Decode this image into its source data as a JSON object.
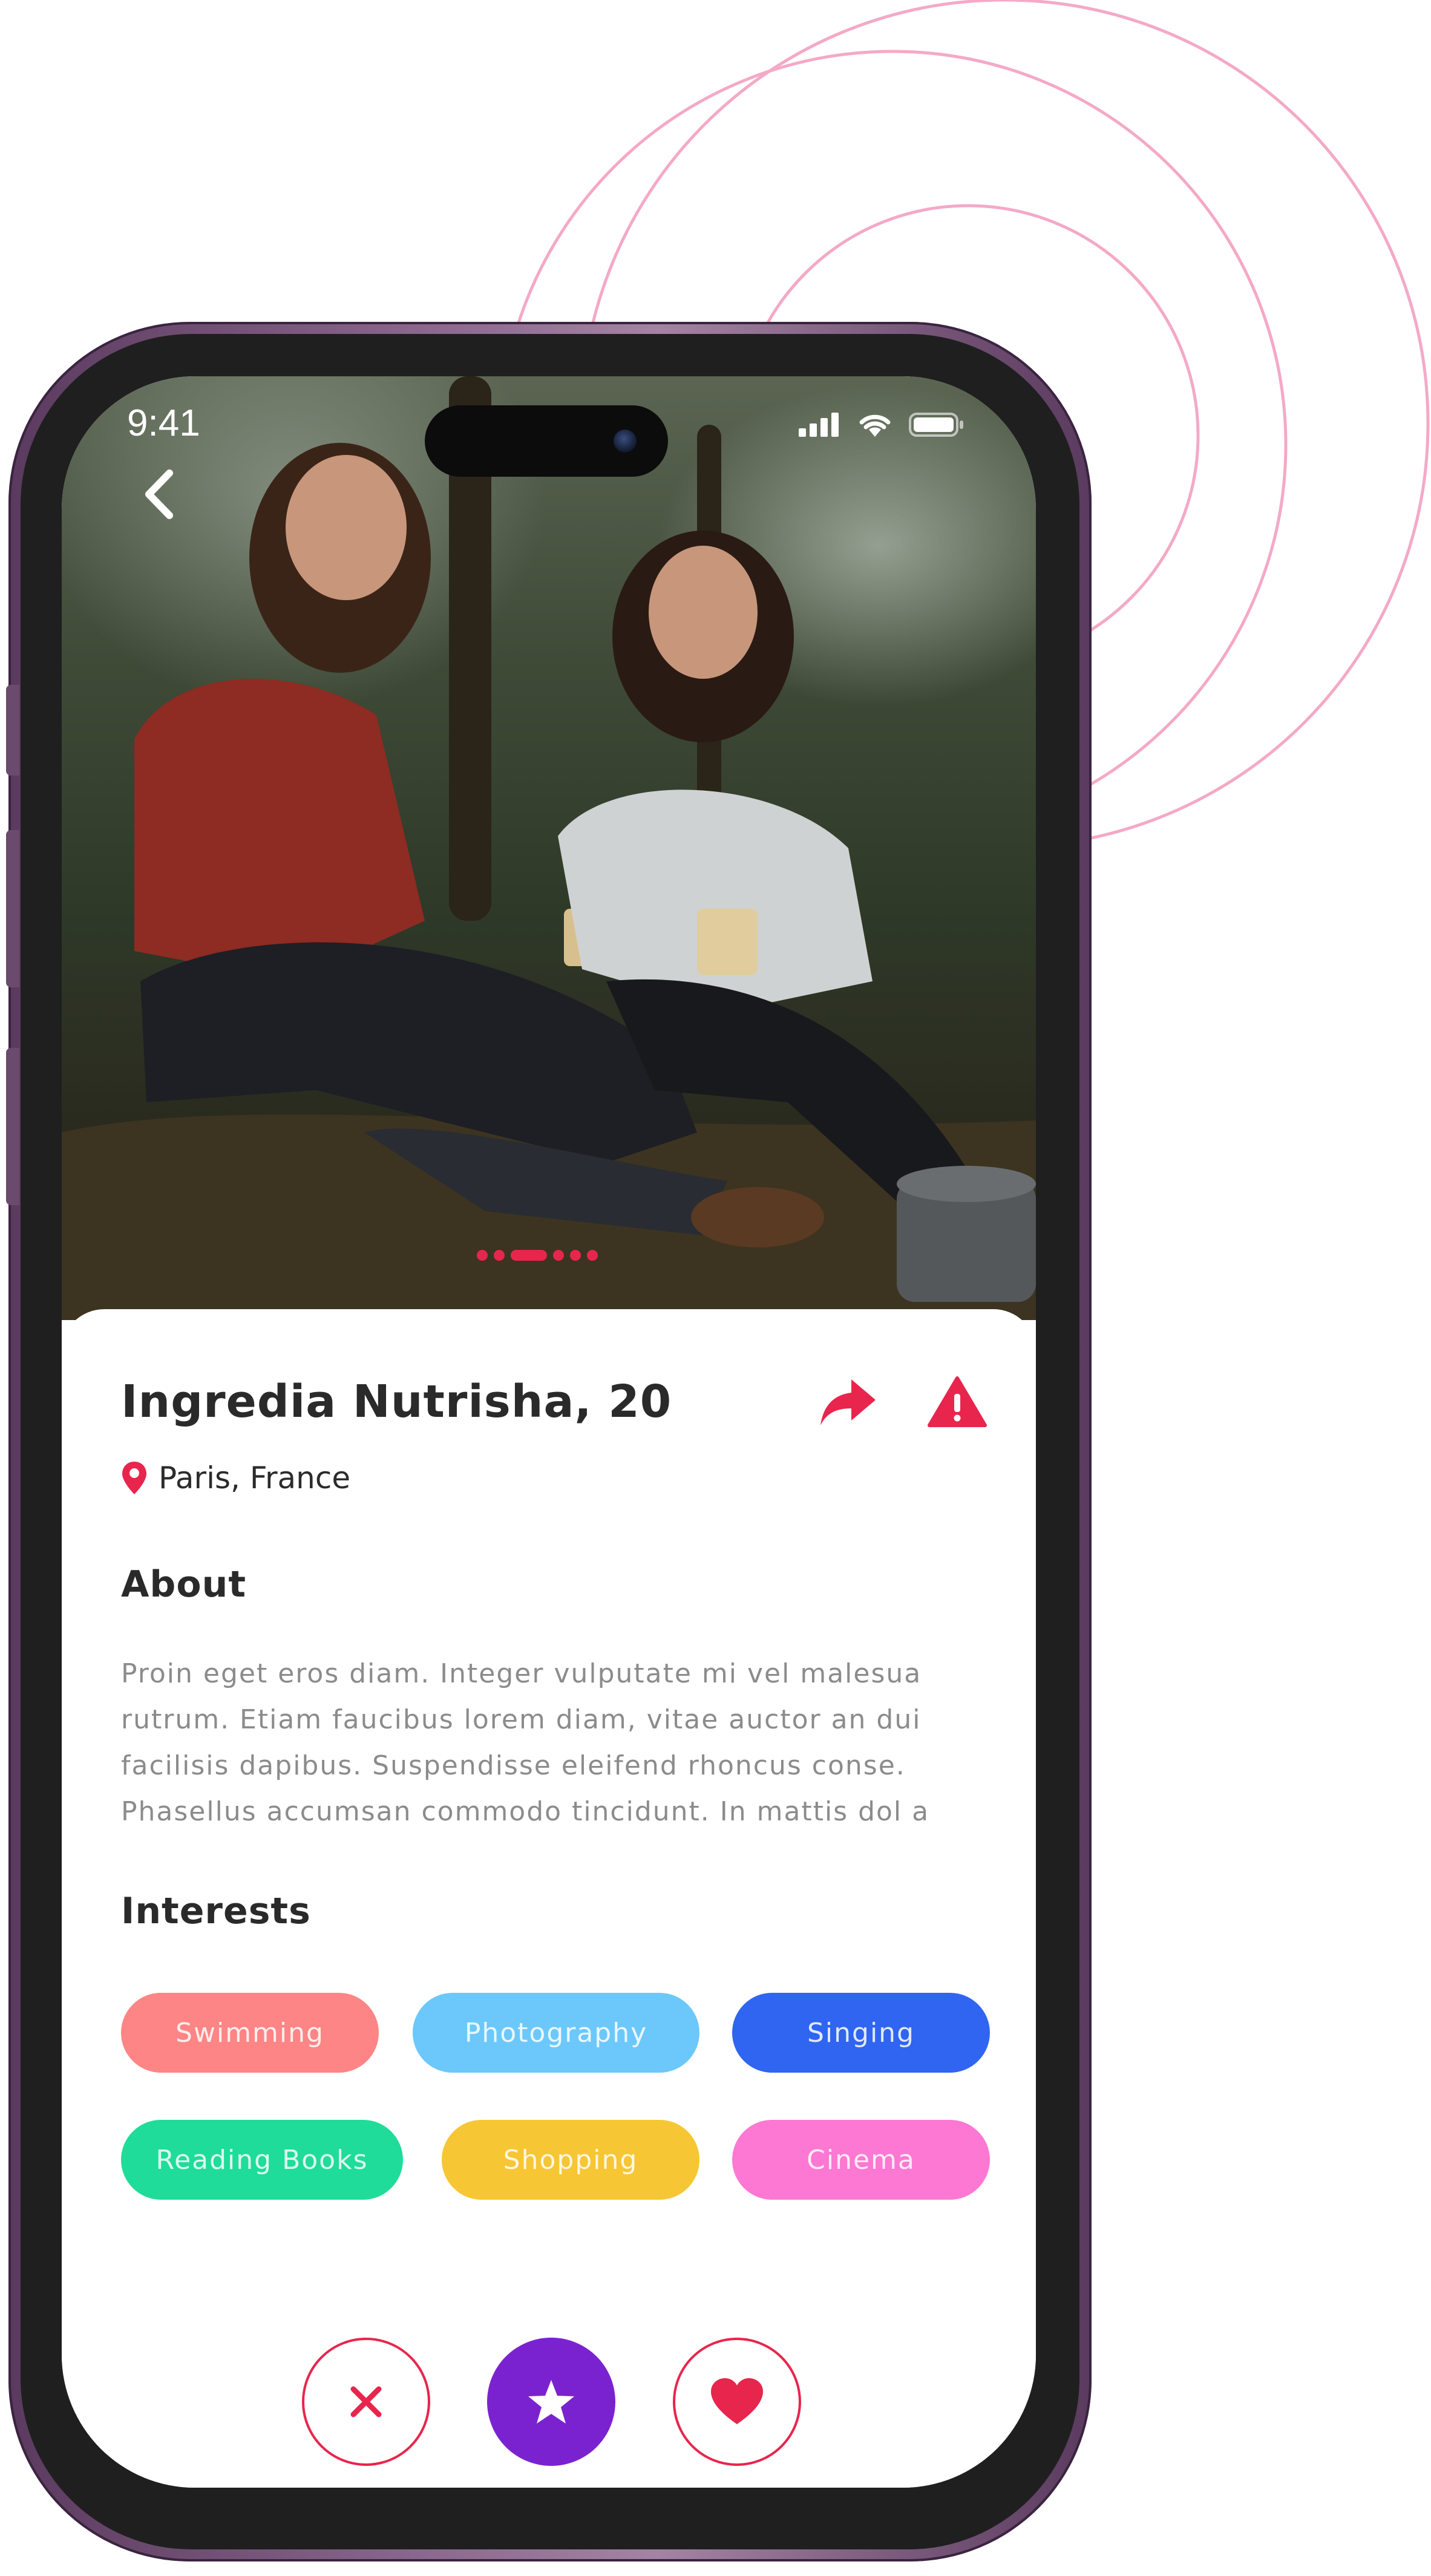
{
  "status_bar": {
    "time": "9:41"
  },
  "profile": {
    "name_age": "Ingredia Nutrisha, 20",
    "location": "Paris, France"
  },
  "about": {
    "title": "About",
    "text": "Proin eget eros diam. Integer vulputate mi vel malesua rutrum. Etiam faucibus lorem diam, vitae auctor an dui facilisis dapibus. Suspendisse eleifend rhoncus conse. Phasellus accumsan commodo tincidunt. In mattis dol a"
  },
  "interests": {
    "title": "Interests",
    "items": [
      {
        "label": "Swimming",
        "color": "#fd8585"
      },
      {
        "label": "Photography",
        "color": "#6cc8fb"
      },
      {
        "label": "Singing",
        "color": "#2f65f0"
      },
      {
        "label": "Reading Books",
        "color": "#1fdc9a"
      },
      {
        "label": "Shopping",
        "color": "#f7c634"
      },
      {
        "label": "Cinema",
        "color": "#fd78d2"
      }
    ]
  },
  "photo_carousel": {
    "count": 6,
    "active_index": 2
  },
  "icons": {
    "back": "chevron-left-icon",
    "share": "share-arrow-icon",
    "report": "warning-icon",
    "location": "location-pin-icon",
    "dislike": "close-icon",
    "superlike": "star-icon",
    "like": "heart-icon"
  },
  "colors": {
    "accent": "#e8254d",
    "superlike": "#7b22d0",
    "ring": "#f4a9c6",
    "phone_frame": "#7d5a80"
  }
}
